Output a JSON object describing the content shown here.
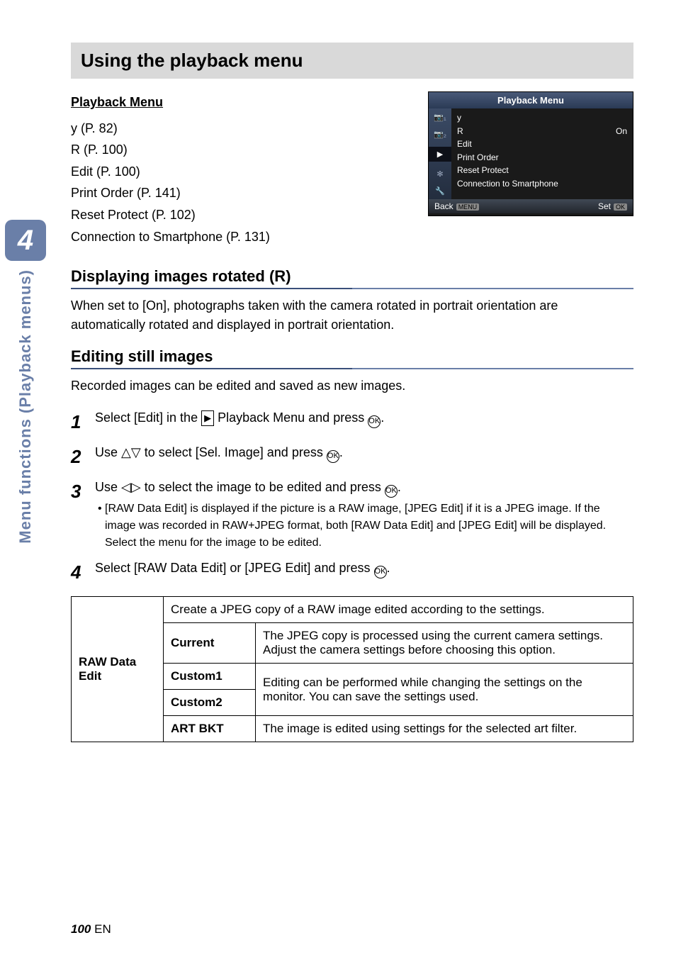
{
  "sidebar": {
    "chapter_num": "4",
    "chapter_title": "Menu functions (Playback menus)"
  },
  "section_title": "Using the playback menu",
  "pb_menu": {
    "heading": "Playback Menu",
    "lines": [
      "y (P. 82)",
      "R (P. 100)",
      "Edit (P. 100)",
      "Print Order (P. 141)",
      "Reset Protect (P. 102)",
      "Connection to Smartphone (P. 131)"
    ]
  },
  "screenshot": {
    "title": "Playback Menu",
    "tabs": [
      "📷₁",
      "📷₂",
      "▶",
      "✻",
      "🔧"
    ],
    "items": [
      {
        "icon": "y",
        "label": "",
        "value": ""
      },
      {
        "icon": "R",
        "label": "",
        "value": "On"
      },
      {
        "icon": "",
        "label": "Edit",
        "value": ""
      },
      {
        "icon": "",
        "label": "Print Order",
        "value": ""
      },
      {
        "icon": "",
        "label": "Reset Protect",
        "value": ""
      },
      {
        "icon": "",
        "label": "Connection to Smartphone",
        "value": ""
      }
    ],
    "footer_left": "Back",
    "footer_left_btn": "MENU",
    "footer_right": "Set",
    "footer_right_btn": "OK"
  },
  "sub1": {
    "title_prefix": "Displaying images rotated (",
    "title_suffix": ")",
    "rotate_icon": "R",
    "para": "When set to [On], photographs taken with the camera rotated in portrait orientation are automatically rotated and displayed in portrait orientation."
  },
  "sub2": {
    "title": "Editing still images",
    "para": "Recorded images can be edited and saved as new images."
  },
  "steps": [
    {
      "n": "1",
      "pre": "Select [Edit] in the ",
      "mid": " Playback Menu and press ",
      "post": "."
    },
    {
      "n": "2",
      "pre": "Use ",
      "arrows": "△▽",
      "mid": " to select [Sel. Image] and press ",
      "post": "."
    },
    {
      "n": "3",
      "pre": "Use ",
      "arrows": "◁▷",
      "mid": " to select the image to be edited and press ",
      "post": ".",
      "bullet": "[RAW Data Edit] is displayed if the picture is a RAW image, [JPEG Edit] if it is a JPEG image. If the image was recorded in RAW+JPEG format, both [RAW Data Edit] and [JPEG Edit] will be displayed. Select the menu for the image to be edited."
    },
    {
      "n": "4",
      "pre": "Select [RAW Data Edit] or [JPEG Edit] and press ",
      "post": "."
    }
  ],
  "table": {
    "row_header": "RAW Data Edit",
    "caption": "Create a JPEG copy of a RAW image edited according to the settings.",
    "rows": [
      {
        "k": "Current",
        "v": "The JPEG copy is processed using the current camera settings. Adjust the camera settings before choosing this option."
      },
      {
        "k": "Custom1",
        "v": "Editing can be performed while changing the settings on the monitor. You can save the settings used."
      },
      {
        "k": "Custom2",
        "v": ""
      },
      {
        "k": "ART BKT",
        "v": "The image is edited using settings for the selected art filter."
      }
    ]
  },
  "footer": {
    "page": "100",
    "lang": "EN"
  }
}
